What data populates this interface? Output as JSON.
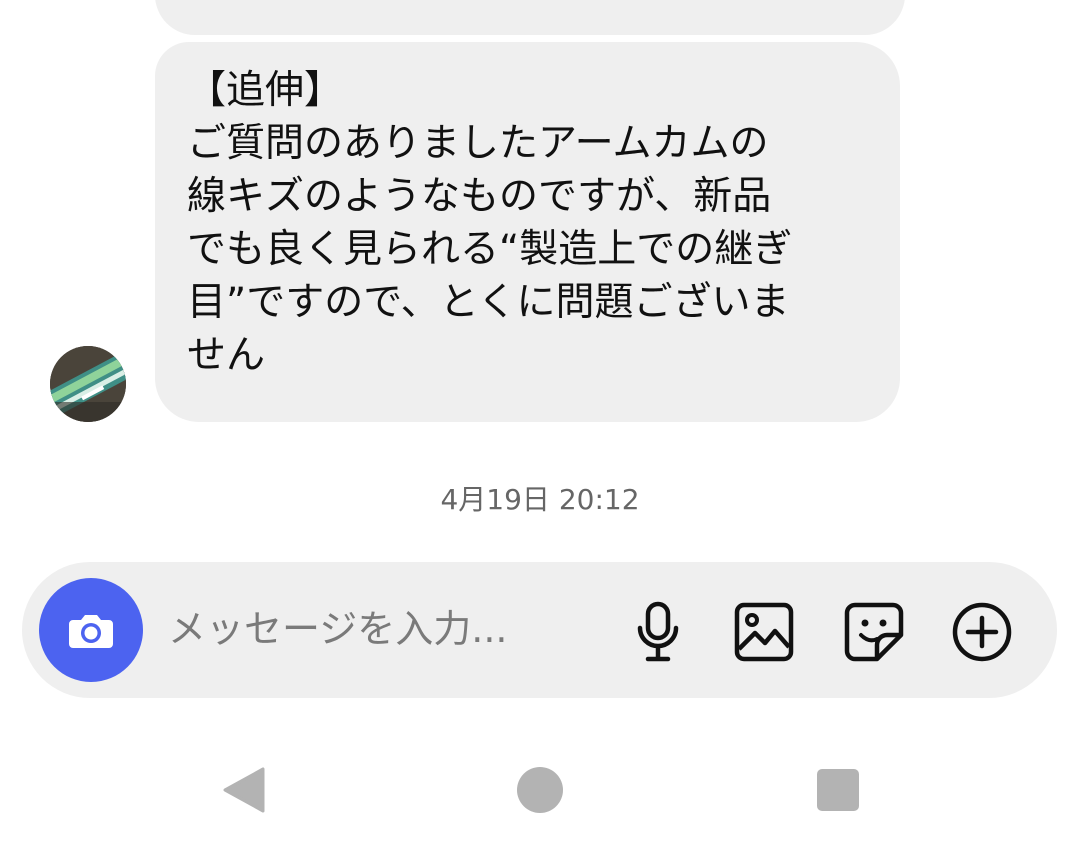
{
  "message": {
    "lines": [
      "【追伸】",
      "ご質問のありましたアームカムの",
      "線キズのようなものですが、新品",
      "でも良く見られる“製造上での継ぎ",
      "目”ですので、とくに問題ございま",
      "せん"
    ]
  },
  "timestamp": "4月19日 20:12",
  "composer": {
    "placeholder": "メッセージを入力...",
    "camera_icon": "camera-icon",
    "mic_icon": "microphone-icon",
    "gallery_icon": "image-icon",
    "sticker_icon": "sticker-icon",
    "add_icon": "plus-circle-icon"
  },
  "navigation": {
    "back_icon": "back-triangle-icon",
    "home_icon": "home-circle-icon",
    "recents_icon": "recents-square-icon"
  },
  "colors": {
    "bubble": "#efefef",
    "accent": "#4c63f0",
    "nav": "#b3b3b3",
    "text": "#111111",
    "muted": "#666666"
  }
}
